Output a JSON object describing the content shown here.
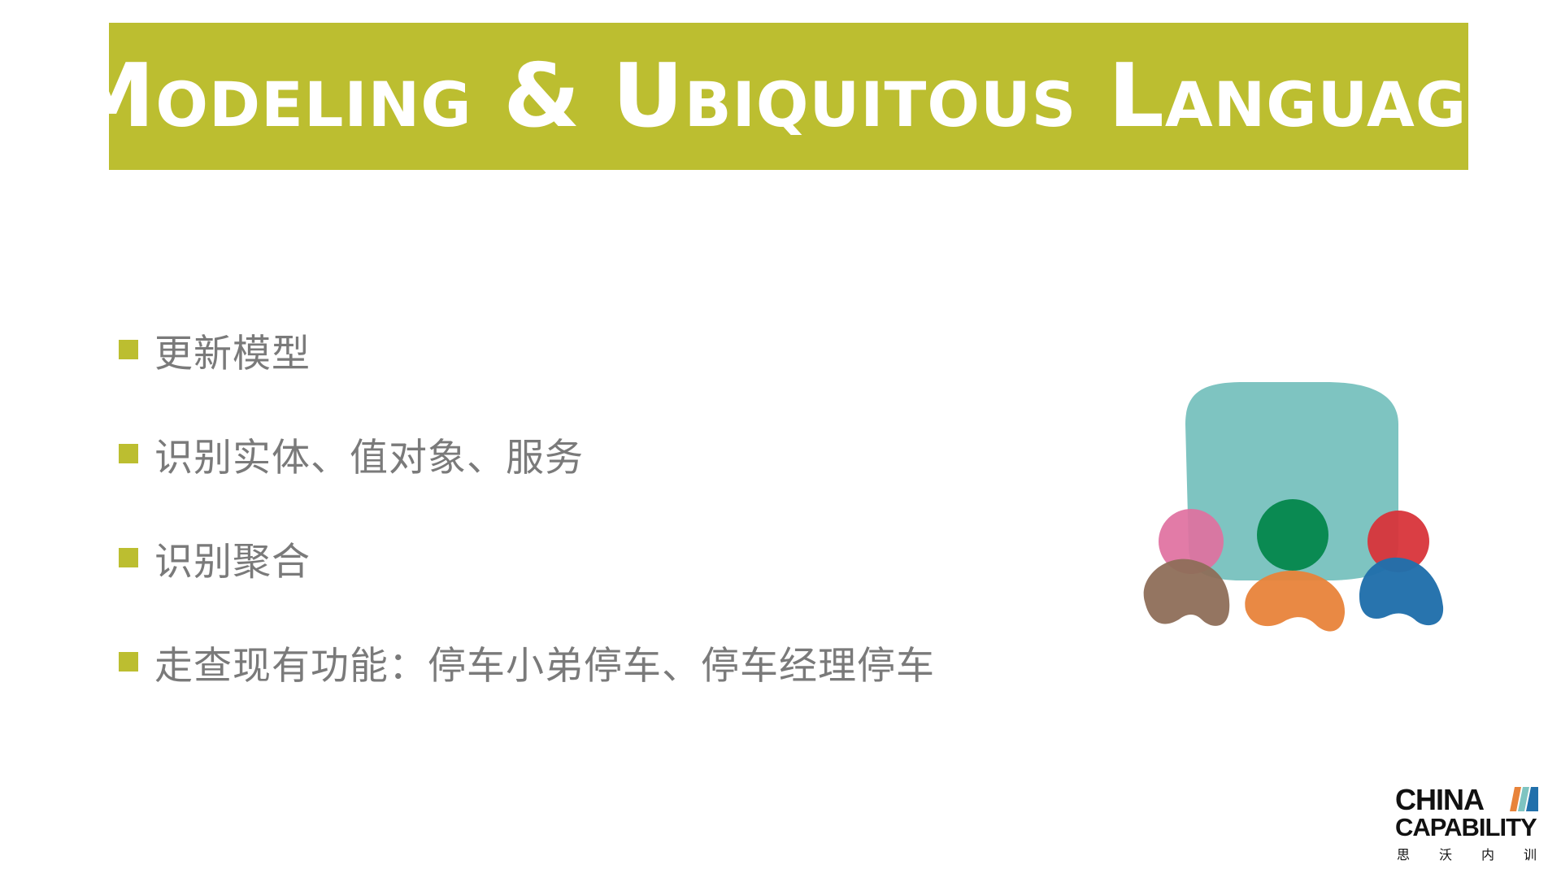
{
  "slide": {
    "title": "Modeling & Ubiquitous Language",
    "accent_color": "#bcbe30",
    "text_color": "#7a7a7a"
  },
  "bullets": [
    {
      "text": "更新模型"
    },
    {
      "text": "识别实体、值对象、服务"
    },
    {
      "text": "识别聚合"
    },
    {
      "text": "走查现有功能：停车小弟停车、停车经理停车"
    }
  ],
  "illustration": {
    "icon": "team-discussion-icon",
    "colors": {
      "bubble": "#7ec4c1",
      "pink": "#e070a0",
      "brown": "#8e6e58",
      "green": "#0a8a52",
      "orange": "#e8833a",
      "red": "#d8343a",
      "blue": "#2170ab"
    }
  },
  "brand": {
    "line1": "CHINA",
    "line2": "CAPABILITY",
    "cn_chars": [
      "思",
      "沃",
      "内",
      "训"
    ],
    "mark_colors": [
      "#e8833a",
      "#7ec4c1",
      "#2170ab"
    ]
  }
}
